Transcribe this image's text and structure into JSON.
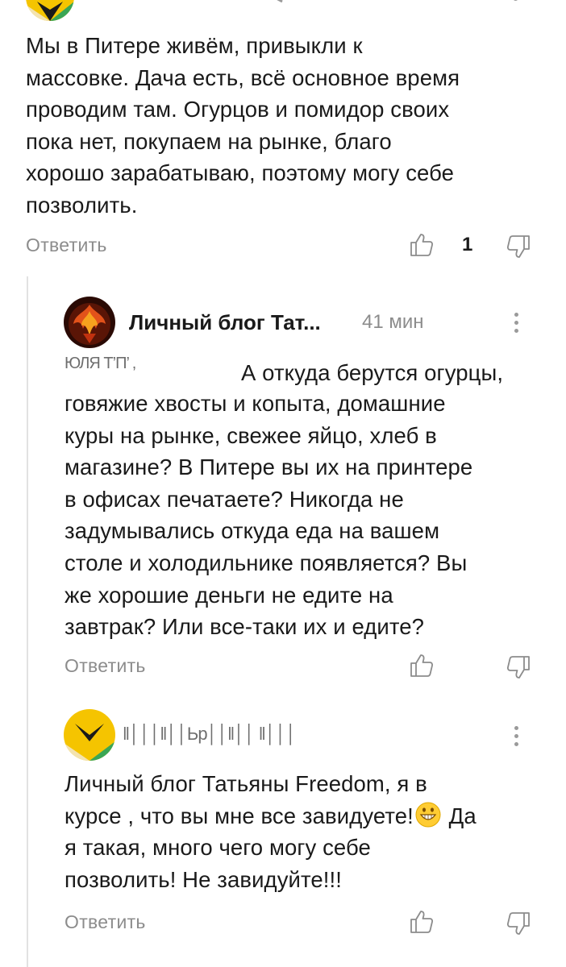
{
  "comments": [
    {
      "text": "Мы в Питере живём, привыкли к\nмассовке. Дача есть, всё основное время\nпроводим там. Огурцов и помидор своих\nпока нет, покупаем на рынке, благо\nхорошо зарабатываю, поэтому могу себе\nпозволить.",
      "reply_label": "Ответить",
      "likes": "1"
    },
    {
      "author": "Личный блог Тат...",
      "time": "41 мин",
      "mention_scribble": "ЮЛЯ          Т’П’     ,",
      "text_first_line": "А откуда берутся огурцы,",
      "text": "говяжие хвосты и копыта, домашние\nкуры на рынке, свежее яйцо, хлеб в\nмагазине? В Питере вы их на принтере\nв офисах печатаете? Никогда не\nзадумывались откуда еда на вашем\nстоле и холодильнике появляется? Вы\nже хорошие деньги не едите на\nзавтрак? Или все-таки их и едите?",
      "reply_label": "Ответить"
    },
    {
      "author_scribble": "‖│││‖││Ьр││‖││   ‖│││",
      "text_part1": "Личный блог Татьяны Freedom, я в\nкурсе , что вы мне все завидуете!",
      "text_part2": " Да\nя такая, много чего могу себе\nпозволить! Не завидуйте!!!",
      "reply_label": "Ответить"
    }
  ],
  "icons": {
    "like": "thumb-up-icon",
    "dislike": "thumb-down-icon",
    "more": "kebab-menu-icon",
    "emoji": "grinning-face-icon"
  },
  "colors": {
    "muted": "#8c8c8c",
    "avatar_yellow": "#f5c400",
    "avatar_green": "#3aa655",
    "thread_line": "#e2e2e2"
  }
}
